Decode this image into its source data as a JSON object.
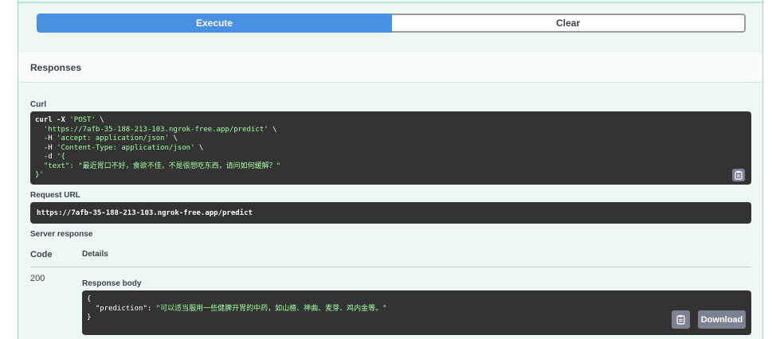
{
  "actions": {
    "execute_label": "Execute",
    "clear_label": "Clear"
  },
  "responses": {
    "title": "Responses"
  },
  "curl": {
    "label": "Curl",
    "lines": [
      "curl -X 'POST' \\",
      "  'https://7afb-35-188-213-103.ngrok-free.app/predict' \\",
      "  -H 'accept: application/json' \\",
      "  -H 'Content-Type: application/json' \\",
      "  -d '{",
      "  \"text\": \"最近胃口不好，食欲不佳，不是很想吃东西，请问如何缓解？\"",
      "}'"
    ],
    "copy_icon": "clipboard-icon"
  },
  "request_url": {
    "label": "Request URL",
    "value": "https://7afb-35-188-213-103.ngrok-free.app/predict"
  },
  "server_response": {
    "label": "Server response",
    "code_header": "Code",
    "details_header": "Details",
    "code": "200",
    "body_label": "Response body",
    "body_lines": [
      "{",
      "  \"prediction\": \"可以适当服用一些健脾开胃的中药，如山楂、神曲、麦芽、鸡内金等。\"",
      "}"
    ],
    "download_label": "Download",
    "copy_icon": "clipboard-icon"
  },
  "colors": {
    "execute_bg": "#4990e2",
    "panel_bg": "#eef8f3",
    "code_bg": "#333333",
    "string_color": "#a2fca2"
  }
}
